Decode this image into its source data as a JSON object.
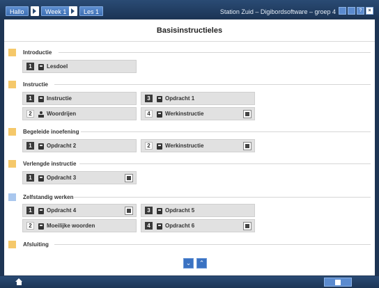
{
  "breadcrumb": [
    "Hallo",
    "Week 1",
    "Les 1"
  ],
  "app_title": "Station Zuid – Digibordsoftware – groep 4",
  "window_buttons": [
    "panel-icon",
    "window-icon",
    "help-icon",
    "close-icon"
  ],
  "window_button_labels": {
    "help": "?",
    "close": "×"
  },
  "page_title": "Basisinstructieles",
  "colors": {
    "section_yellow": "#f5c86a",
    "section_blue": "#a9c7ee",
    "bar": "#1e3554",
    "accent": "#3a72c2"
  },
  "sections": [
    {
      "label": "Introductie",
      "marker": "yellow",
      "items": [
        {
          "num": "1",
          "label": "Lesdoel",
          "icon": "book-icon",
          "num_style": "dark"
        }
      ]
    },
    {
      "label": "Instructie",
      "marker": "yellow",
      "items": [
        {
          "num": "1",
          "label": "Instructie",
          "icon": "book-icon",
          "num_style": "dark"
        },
        {
          "num": "3",
          "label": "Opdracht 1",
          "icon": "book-icon",
          "num_style": "dark"
        },
        {
          "num": "2",
          "label": "Woordrijen",
          "icon": "people-icon",
          "num_style": "light"
        },
        {
          "num": "4",
          "label": "Werkinstructie",
          "icon": "book-icon",
          "num_style": "light",
          "badge": "dice-icon"
        }
      ]
    },
    {
      "label": "Begeleide inoefening",
      "marker": "yellow",
      "items": [
        {
          "num": "1",
          "label": "Opdracht 2",
          "icon": "book-icon",
          "num_style": "dark"
        },
        {
          "num": "2",
          "label": "Werkinstructie",
          "icon": "book-icon",
          "num_style": "light",
          "badge": "dice-icon"
        }
      ]
    },
    {
      "label": "Verlengde instructie",
      "marker": "yellow",
      "items": [
        {
          "num": "1",
          "label": "Opdracht 3",
          "icon": "book-icon",
          "num_style": "dark",
          "badge": "image-icon"
        }
      ]
    },
    {
      "label": "Zelfstandig werken",
      "marker": "blue",
      "items": [
        {
          "num": "1",
          "label": "Opdracht 4",
          "icon": "book-icon",
          "num_style": "dark",
          "badge": "image-icon"
        },
        {
          "num": "3",
          "label": "Opdracht 5",
          "icon": "book-icon",
          "num_style": "dark"
        },
        {
          "num": "2",
          "label": "Moeilijke woorden",
          "icon": "book-icon",
          "num_style": "light"
        },
        {
          "num": "4",
          "label": "Opdracht 6",
          "icon": "book-icon",
          "num_style": "dark",
          "badge": "dice-icon"
        }
      ]
    },
    {
      "label": "Afsluiting",
      "marker": "yellow",
      "items": []
    }
  ],
  "scroll": {
    "down": "⌄",
    "up": "⌃"
  }
}
